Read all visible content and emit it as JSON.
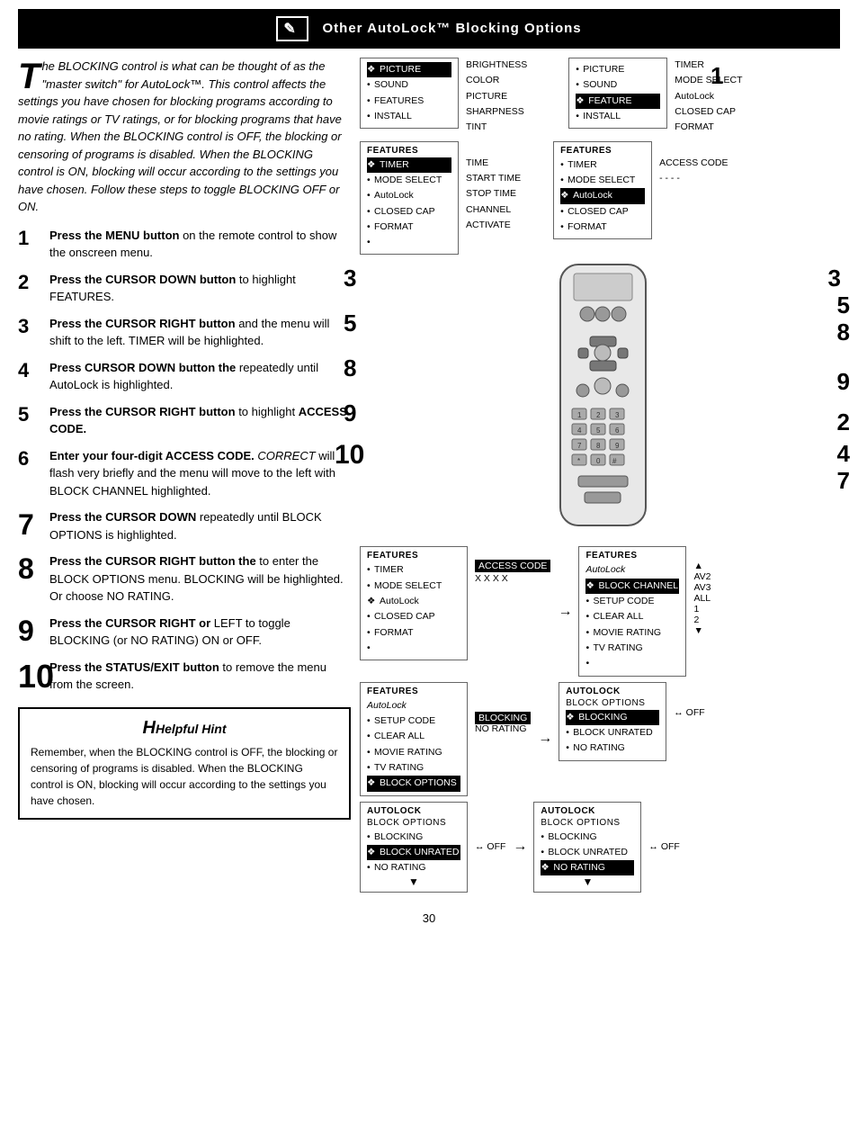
{
  "header": {
    "title": "Other AutoLock™ Blocking Options"
  },
  "intro": {
    "text": "he BLOCKING control is what can be thought of as the \"master switch\" for AutoLock™. This control affects the settings you have chosen for blocking programs according to movie ratings or TV ratings, or for blocking programs that have no rating. When the BLOCKING control is OFF, the blocking or censoring of programs is disabled. When the BLOCKING control is ON, blocking will occur according to the settings you have chosen. Follow these steps to toggle BLOCKING OFF or ON."
  },
  "steps": [
    {
      "number": "1",
      "text": "Press the MENU button on the remote control to show the onscreen menu."
    },
    {
      "number": "2",
      "text": "Press the CURSOR DOWN button to highlight FEATURES."
    },
    {
      "number": "3",
      "text": "Press the CURSOR RIGHT button and the menu will shift to the left. TIMER will be highlighted."
    },
    {
      "number": "4",
      "text": "Press the CURSOR DOWN button repeatedly until AutoLock is highlighted."
    },
    {
      "number": "5",
      "text": "Press the CURSOR RIGHT button to highlight ACCESS CODE."
    },
    {
      "number": "6",
      "text": "Enter your four-digit ACCESS CODE. CORRECT will flash very briefly and the menu will move to the left with BLOCK CHANNEL highlighted."
    },
    {
      "number": "7",
      "text": "Press the CURSOR DOWN repeatedly until BLOCK OPTIONS is highlighted."
    },
    {
      "number": "8",
      "text": "Press the CURSOR RIGHT to enter the BLOCK OPTIONS menu. BLOCKING will be highlighted. Or choose NO RATING."
    },
    {
      "number": "9",
      "text": "Press the CURSOR RIGHT or LEFT to toggle BLOCKING (or NO RATING) ON or OFF."
    },
    {
      "number": "10",
      "text": "Press the STATUS/EXIT button to remove the menu from the screen."
    }
  ],
  "hint": {
    "title": "Helpful Hint",
    "text": "Remember, when the BLOCKING control is OFF, the blocking or censoring of programs is disabled. When the BLOCKING control is ON, blocking will occur according to the settings you have chosen."
  },
  "page_number": "30",
  "menus": {
    "step1_left": {
      "title": "",
      "items": [
        "❖• PICTURE",
        "• SOUND",
        "• FEATURES",
        "• INSTALL"
      ],
      "right_items": [
        "BRIGHTNESS",
        "COLOR",
        "PICTURE",
        "SHARPNESS",
        "TINT"
      ]
    },
    "step1_right": {
      "items": [
        "• PICTURE",
        "• SOUND",
        "❖• FEATURE (selected)",
        "• INSTALL"
      ],
      "right_items": [
        "TIMER",
        "MODE SELECT",
        "AutoLock",
        "CLOSED CAP",
        "FORMAT"
      ]
    },
    "step2_left": {
      "title": "FEATURES",
      "items": [
        "❖• TIMER (selected)",
        "• MODE SELECT",
        "• AutoLock",
        "• CLOSED CAP",
        "• FORMAT",
        "•"
      ],
      "right_items": [
        "TIME",
        "START TIME",
        "STOP TIME",
        "CHANNEL",
        "ACTIVATE"
      ]
    },
    "step2_right": {
      "title": "FEATURES",
      "items": [
        "• TIMER",
        "• MODE SELECT",
        "❖• AutoLock (selected)",
        "• CLOSED CAP",
        "• FORMAT"
      ],
      "right_items": [
        "ACCESS CODE",
        "----"
      ]
    },
    "step3_left": {
      "title": "FEATURES",
      "items": [
        "• TIMER",
        "• MODE SELECT",
        "❖• AutoLock (selected)",
        "• CLOSED CAP",
        "• FORMAT",
        "•"
      ],
      "access_code": "X X X X"
    },
    "step3_right": {
      "title": "FEATURES",
      "sub": "AutoLock",
      "items": [
        "❖• BLOCK CHANNEL",
        "• SETUP CODE",
        "• CLEAR ALL",
        "• MOVIE RATING",
        "• TV RATING",
        "•"
      ],
      "right_items": [
        "AV2",
        "AV3",
        "ALL",
        "1",
        "2"
      ]
    },
    "step4_left": {
      "title": "FEATURES",
      "sub": "AutoLock",
      "items": [
        "• SETUP CODE",
        "• CLEAR ALL",
        "• MOVIE RATING",
        "• TV RATING",
        "❖• BLOCK OPTIONS (selected)"
      ],
      "right_items": [
        "BLOCKING",
        "NO RATING"
      ]
    },
    "step4_right": {
      "title": "AutoLock",
      "sub": "BLOCK OPTIONS",
      "items": [
        "❖• BLOCKING (selected)",
        "• BLOCK UNRATED",
        "• NO RATING"
      ],
      "right_items": [
        "❖• OFF"
      ]
    },
    "step5_left": {
      "title": "AutoLock",
      "sub": "BLOCK OPTIONS",
      "items": [
        "• BLOCKING",
        "❖• BLOCK UNRATED",
        "• NO RATING"
      ],
      "right_items": [
        "❖• OFF"
      ]
    },
    "step5_right": {
      "title": "AutoLock",
      "sub": "BLOCK OPTIONS",
      "items": [
        "• BLOCKING",
        "• BLOCK UNRATED",
        "❖• NO RATING (selected)"
      ],
      "right_items": [
        "❖• OFF"
      ]
    }
  }
}
